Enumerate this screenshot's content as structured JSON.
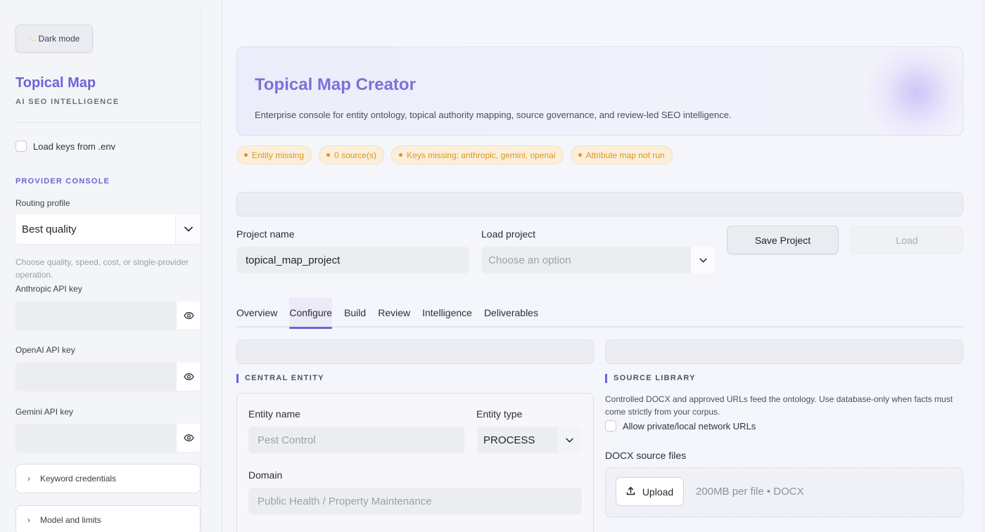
{
  "sidebar": {
    "dark_mode": "Dark mode",
    "dark_mode_icon": "moon-icon",
    "brand_title": "Topical Map",
    "brand_subtitle": "AI SEO INTELLIGENCE",
    "load_env_label": "Load keys from .env",
    "provider_console": "PROVIDER CONSOLE",
    "routing_label": "Routing profile",
    "routing_value": "Best quality",
    "routing_help": "Choose quality, speed, cost, or single-provider operation.",
    "anthropic_label": "Anthropic API key",
    "openai_label": "OpenAI API key",
    "gemini_label": "Gemini API key",
    "keyword_credentials": "Keyword credentials",
    "model_limits": "Model and limits"
  },
  "hero": {
    "title": "Topical Map Creator",
    "description": "Enterprise console for entity ontology, topical authority mapping, source governance, and review-led SEO intelligence."
  },
  "badges": [
    "Entity missing",
    "0 source(s)",
    "Keys missing: anthropic, gemini, openai",
    "Attribute map not run"
  ],
  "project": {
    "name_label": "Project name",
    "name_value": "topical_map_project",
    "load_label": "Load project",
    "load_placeholder": "Choose an option",
    "save_button": "Save Project",
    "load_button": "Load"
  },
  "tabs": [
    "Overview",
    "Configure",
    "Build",
    "Review",
    "Intelligence",
    "Deliverables"
  ],
  "active_tab": "Configure",
  "central_entity": {
    "heading": "CENTRAL ENTITY",
    "entity_name_label": "Entity name",
    "entity_name_placeholder": "Pest Control",
    "entity_type_label": "Entity type",
    "entity_type_value": "PROCESS",
    "domain_label": "Domain",
    "domain_placeholder": "Public Health / Property Maintenance"
  },
  "source_library": {
    "heading": "SOURCE LIBRARY",
    "description": "Controlled DOCX and approved URLs feed the ontology. Use database-only when facts must come strictly from your corpus.",
    "private_urls_label": "Allow private/local network URLs",
    "docx_label": "DOCX source files",
    "upload_button": "Upload",
    "upload_hint": "200MB per file • DOCX"
  },
  "colors": {
    "accent": "#6d63d8",
    "warning": "#e0951a",
    "warning_bg": "#fbefdc"
  }
}
